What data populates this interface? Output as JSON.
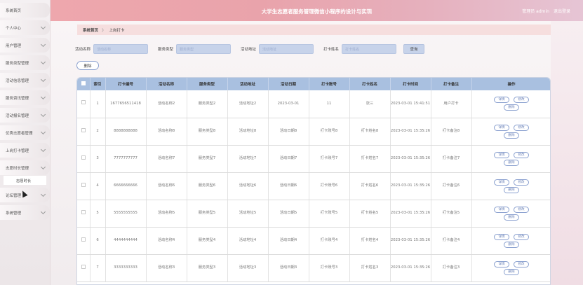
{
  "header": {
    "title": "大学生志愿者服务管理微信小程序的设计与实现",
    "user_label": "管理员 admin",
    "logout_label": "退出登录"
  },
  "sidebar": {
    "items": [
      {
        "label": "系统首页",
        "chevron": false
      },
      {
        "label": "个人中心",
        "chevron": true
      },
      {
        "label": "用户管理",
        "chevron": true
      },
      {
        "label": "服务类型管理",
        "chevron": true
      },
      {
        "label": "活动信息管理",
        "chevron": true
      },
      {
        "label": "服务资讯管理",
        "chevron": true
      },
      {
        "label": "活动报名管理",
        "chevron": true
      },
      {
        "label": "优秀志愿者管理",
        "chevron": true
      },
      {
        "label": "上岗打卡管理",
        "chevron": true
      },
      {
        "label": "志愿时长管理",
        "chevron": true,
        "expanded": true
      }
    ],
    "sub_item": "志愿时长",
    "items_after": [
      {
        "label": "论坛管理",
        "chevron": true
      },
      {
        "label": "系统管理",
        "chevron": true
      }
    ]
  },
  "breadcrumb": {
    "home": "系统首页",
    "sep": "》",
    "current": "上岗打卡"
  },
  "filters": {
    "activity_name_label": "活动名称",
    "activity_name_placeholder": "活动名称",
    "service_type_label": "服务类型",
    "service_type_placeholder": "服务类型",
    "activity_place_label": "活动地址",
    "activity_place_placeholder": "活动地址",
    "checkin_name_label": "打卡姓名",
    "checkin_name_placeholder": "打卡姓名",
    "query_label": "查询"
  },
  "delete_label": "删除",
  "table": {
    "headers": [
      "索引",
      "打卡编号",
      "活动名称",
      "服务类型",
      "活动地址",
      "活动日期",
      "打卡账号",
      "打卡姓名",
      "打卡时间",
      "打卡备注",
      "操作"
    ],
    "op_labels": {
      "detail": "详情",
      "edit": "修改",
      "delete": "删除"
    },
    "rows": [
      {
        "index": "1",
        "code": "1677656511418",
        "name": "活动名称2",
        "type": "服务类型2",
        "place": "活动地址2",
        "date": "2023-03-01",
        "account": "11",
        "person": "张三",
        "time": "2023-03-01 15:41:51",
        "note": "用户打卡"
      },
      {
        "index": "2",
        "code": "8888888888",
        "name": "活动名称8",
        "type": "服务类型8",
        "place": "活动地址8",
        "date": "活动日期8",
        "account": "打卡账号8",
        "person": "打卡姓名8",
        "time": "2023-03-01 15:35:26",
        "note": "打卡备注8"
      },
      {
        "index": "3",
        "code": "7777777777",
        "name": "活动名称7",
        "type": "服务类型7",
        "place": "活动地址7",
        "date": "活动日期7",
        "account": "打卡账号7",
        "person": "打卡姓名7",
        "time": "2023-03-01 15:35:26",
        "note": "打卡备注7"
      },
      {
        "index": "4",
        "code": "6666666666",
        "name": "活动名称6",
        "type": "服务类型6",
        "place": "活动地址6",
        "date": "活动日期6",
        "account": "打卡账号6",
        "person": "打卡姓名6",
        "time": "2023-03-01 15:35:26",
        "note": "打卡备注6"
      },
      {
        "index": "5",
        "code": "5555555555",
        "name": "活动名称5",
        "type": "服务类型5",
        "place": "活动地址5",
        "date": "活动日期5",
        "account": "打卡账号5",
        "person": "打卡姓名5",
        "time": "2023-03-01 15:35:26",
        "note": "打卡备注5"
      },
      {
        "index": "6",
        "code": "4444444444",
        "name": "活动名称4",
        "type": "服务类型4",
        "place": "活动地址4",
        "date": "活动日期4",
        "account": "打卡账号4",
        "person": "打卡姓名4",
        "time": "2023-03-01 15:35:26",
        "note": "打卡备注4"
      },
      {
        "index": "7",
        "code": "3333333333",
        "name": "活动名称3",
        "type": "服务类型3",
        "place": "活动地址3",
        "date": "活动日期3",
        "account": "打卡账号3",
        "person": "打卡姓名3",
        "time": "2023-03-01 15:35:26",
        "note": "打卡备注3"
      }
    ]
  },
  "colors": {
    "header_pink": "#eea7ad",
    "table_header_blue": "#a9c0e0",
    "input_blue": "#c7d3ea",
    "button_border": "#8aa0cf"
  }
}
